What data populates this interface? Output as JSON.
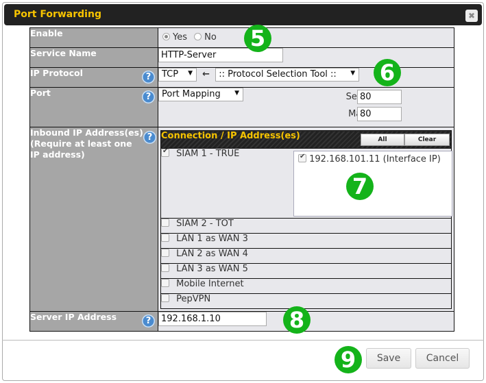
{
  "dialog": {
    "title": "Port Forwarding",
    "close_icon": "close-icon"
  },
  "form": {
    "enable": {
      "label": "Enable",
      "options": [
        "Yes",
        "No"
      ],
      "selected": "Yes"
    },
    "service_name": {
      "label": "Service Name",
      "value": "HTTP-Server"
    },
    "ip_protocol": {
      "label": "IP Protocol",
      "value": "TCP",
      "arrow": "←",
      "tool_value": ":: Protocol Selection Tool ::"
    },
    "port": {
      "label": "Port",
      "value": "Port Mapping",
      "service_port_label": "Service Port:",
      "service_port": "80",
      "map_port_label": "Map to Port:",
      "map_port": "80"
    },
    "inbound": {
      "label_line1": "Inbound IP Address(es)",
      "label_line2": "(Require at least one",
      "label_line3": "IP address)",
      "header": "Connection / IP Address(es)",
      "all_label": "All",
      "clear_label": "Clear",
      "connections": [
        {
          "name": "SIAM 1 - TRUE",
          "checked": true
        },
        {
          "name": "SIAM 2 - TOT",
          "checked": false
        },
        {
          "name": "LAN 1 as WAN 3",
          "checked": false
        },
        {
          "name": "LAN 2 as WAN 4",
          "checked": false
        },
        {
          "name": "LAN 3 as WAN 5",
          "checked": false
        },
        {
          "name": "Mobile Internet",
          "checked": false
        },
        {
          "name": "PepVPN",
          "checked": false
        }
      ],
      "ip_entry": {
        "value": "192.168.101.11 (Interface IP)",
        "checked": true
      }
    },
    "server_ip": {
      "label": "Server IP Address",
      "value": "192.168.1.10"
    }
  },
  "help_glyph": "?",
  "badges": [
    "5",
    "6",
    "7",
    "8",
    "9"
  ],
  "footer": {
    "save_label": "Save",
    "cancel_label": "Cancel"
  },
  "colors": {
    "title": "#f7c400",
    "badge": "#14b31a",
    "label_bg": "#a6a6a6"
  }
}
